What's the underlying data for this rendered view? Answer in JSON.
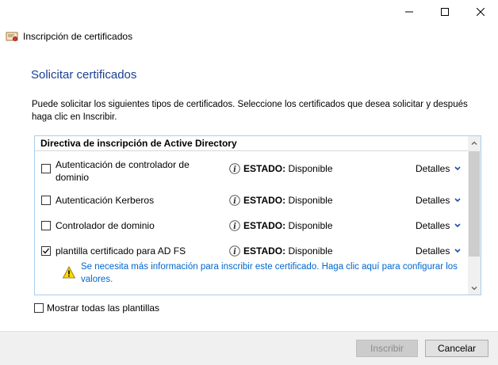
{
  "window": {
    "title": "Inscripción de certificados",
    "controls": [
      "minimize-icon",
      "maximize-icon",
      "close-icon"
    ]
  },
  "page": {
    "title": "Solicitar certificados",
    "description": "Puede solicitar los siguientes tipos de certificados. Seleccione los certificados que desea solicitar y después haga clic en Inscribir."
  },
  "list": {
    "group_header": "Directiva de inscripción de Active Directory",
    "items": [
      {
        "name": "Autenticación de controlador de dominio",
        "checked": false,
        "status_label": "ESTADO:",
        "status_value": "Disponible",
        "details": "Detalles"
      },
      {
        "name": "Autenticación Kerberos",
        "checked": false,
        "status_label": "ESTADO:",
        "status_value": "Disponible",
        "details": "Detalles"
      },
      {
        "name": "Controlador de dominio",
        "checked": false,
        "status_label": "ESTADO:",
        "status_value": "Disponible",
        "details": "Detalles"
      },
      {
        "name": "plantilla certificado para AD FS",
        "checked": true,
        "status_label": "ESTADO:",
        "status_value": "Disponible",
        "details": "Detalles"
      }
    ],
    "warning": "Se necesita más información para inscribir este certificado. Haga clic aquí para configurar los valores."
  },
  "options": {
    "show_all_label": "Mostrar todas las plantillas",
    "show_all_checked": false
  },
  "buttons": {
    "enroll": "Inscribir",
    "enroll_enabled": false,
    "cancel": "Cancelar"
  },
  "colors": {
    "title_blue": "#1a3f95",
    "link_blue": "#0066cc",
    "list_border": "#aacde9",
    "chevron": "#1a4fb0"
  }
}
